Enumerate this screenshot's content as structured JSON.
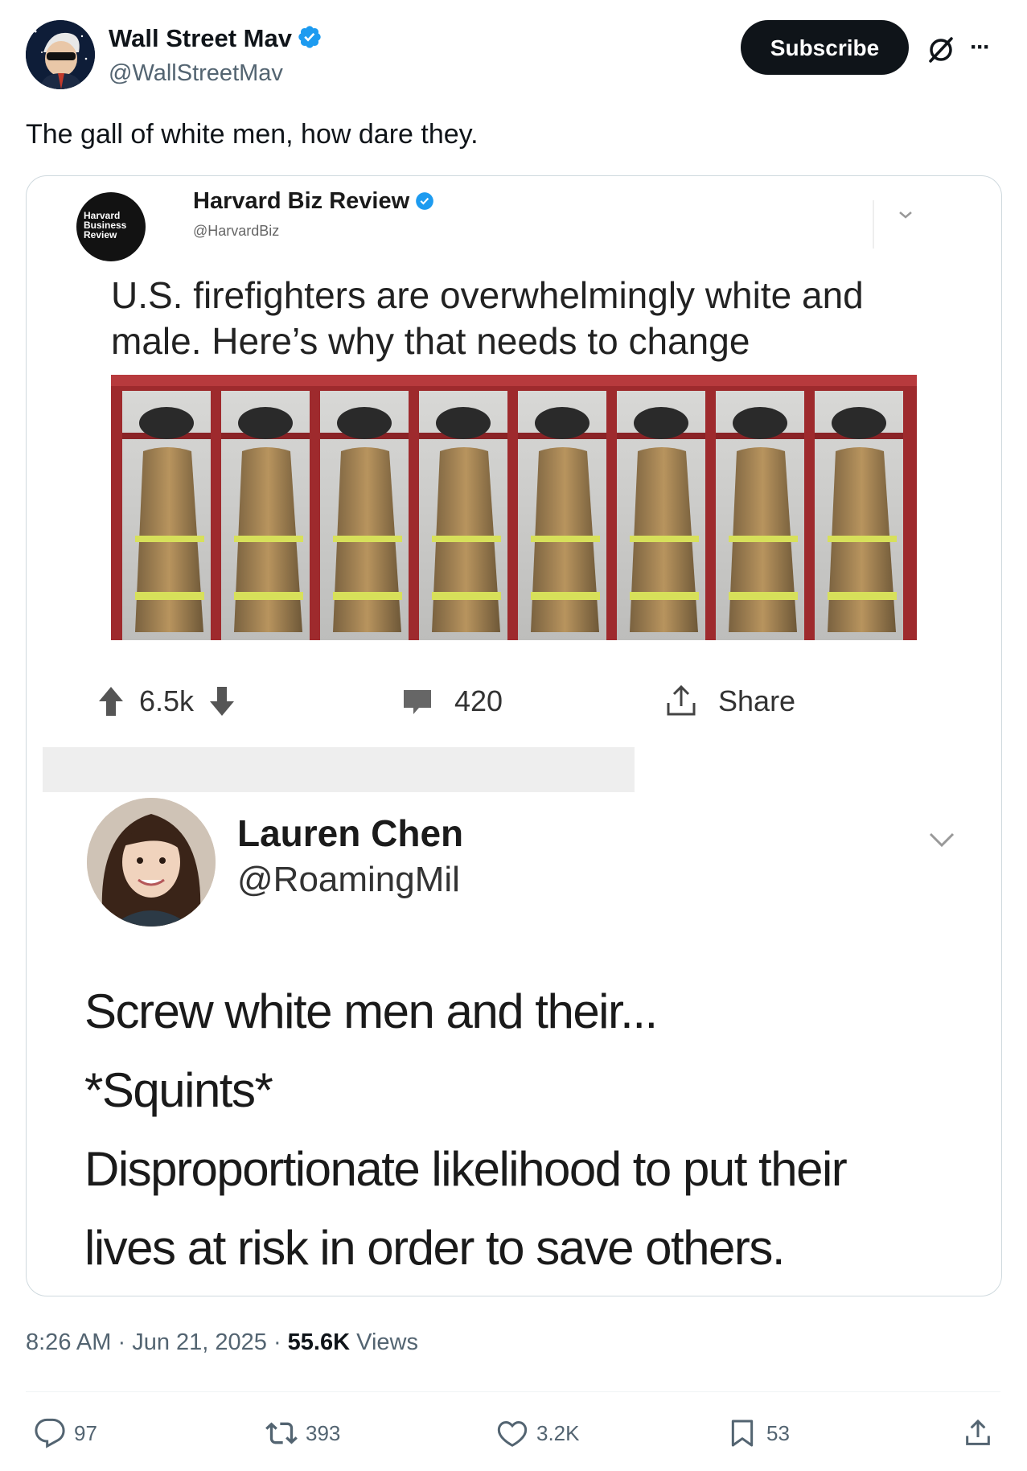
{
  "author": {
    "name": "Wall Street Mav",
    "handle": "@WallStreetMav",
    "subscribe_label": "Subscribe",
    "more_label": "···"
  },
  "tweet": {
    "text": "The gall of white men, how dare they."
  },
  "embedded_post": {
    "name": "Harvard Biz Review",
    "handle": "@HarvardBiz",
    "logo_text": "Harvard Business Review",
    "text": "U.S. firefighters are overwhelmingly white and male. Here’s why that needs to change",
    "votes": "6.5k",
    "comments": "420",
    "share_label": "Share"
  },
  "reply": {
    "name": "Lauren Chen",
    "handle": "@RoamingMil",
    "lines": [
      "Screw white men and their...",
      "*Squints*",
      "Disproportionate likelihood to put their",
      "lives at risk in order to save others."
    ]
  },
  "meta": {
    "time": "8:26 AM",
    "sep": " · ",
    "date": "Jun 21, 2025",
    "views_count": "55.6K",
    "views_label": " Views"
  },
  "actions": {
    "replies": "97",
    "reposts": "393",
    "likes": "3.2K",
    "bookmarks": "53"
  },
  "colors": {
    "text": "#0f1419",
    "secondary": "#536471",
    "verified": "#1d9bf0",
    "border": "#cfd9de"
  }
}
